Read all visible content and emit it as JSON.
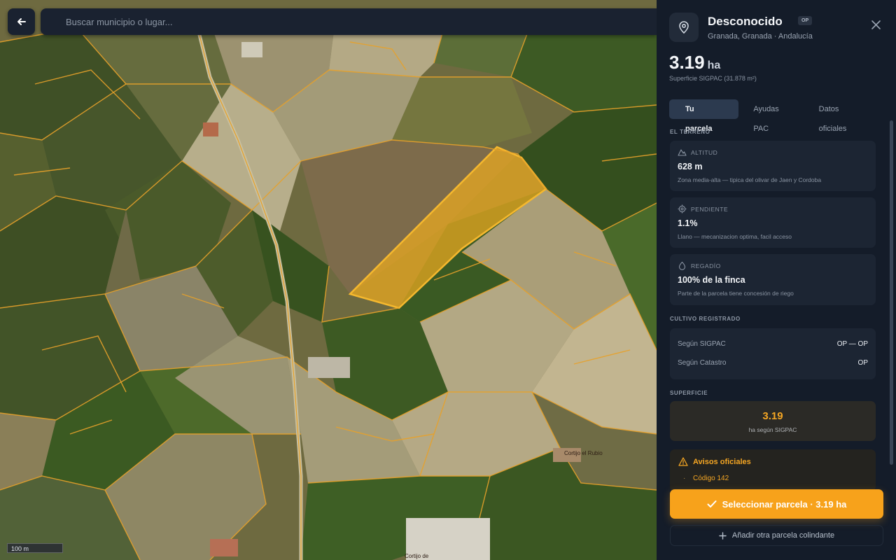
{
  "map": {
    "search_placeholder": "Buscar municipio o lugar...",
    "scale_label": "100 m",
    "place_labels": [
      "Cortijo el Rubio",
      "Cortijo de"
    ]
  },
  "parcel": {
    "title": "Desconocido",
    "badge": "OP",
    "location": "Granada, Granada · Andalucía",
    "area_value": "3.19",
    "area_unit": "ha",
    "area_caption": "Superficie SIGPAC (31.878 m²)"
  },
  "tabs": [
    {
      "label": "Tu parcela",
      "active": true
    },
    {
      "label": "Ayudas PAC",
      "active": false
    },
    {
      "label": "Datos oficiales",
      "active": false
    }
  ],
  "terreno": {
    "section_label": "EL TERRENO",
    "cards": [
      {
        "icon": "mountain-icon",
        "label": "ALTITUD",
        "value": "628 m",
        "desc": "Zona media-alta — tipica del olivar de Jaen y Cordoba"
      },
      {
        "icon": "target-icon",
        "label": "PENDIENTE",
        "value": "1.1%",
        "desc": "Llano — mecanizacion optima, facil acceso"
      },
      {
        "icon": "water-drop-icon",
        "label": "REGADÍO",
        "value": "100% de la finca",
        "desc": "Parte de la parcela tiene concesión de riego"
      }
    ]
  },
  "cultivo": {
    "section_label": "CULTIVO REGISTRADO",
    "rows": [
      {
        "label": "Según SIGPAC",
        "value": "OP — OP"
      },
      {
        "label": "Según Catastro",
        "value": "OP"
      }
    ]
  },
  "superficie": {
    "section_label": "SUPERFICIE",
    "value": "3.19",
    "caption": "ha según SIGPAC"
  },
  "avisos": {
    "title": "Avisos oficiales",
    "items": [
      "Código 142"
    ]
  },
  "actions": {
    "select_label": "Seleccionar parcela · 3.19 ha",
    "add_label": "Añadir otra parcela colindante"
  },
  "colors": {
    "accent": "#f7a21b",
    "panel_bg": "#141c29",
    "card_bg": "#1c2533",
    "parcel_highlight": "#e8a820"
  }
}
